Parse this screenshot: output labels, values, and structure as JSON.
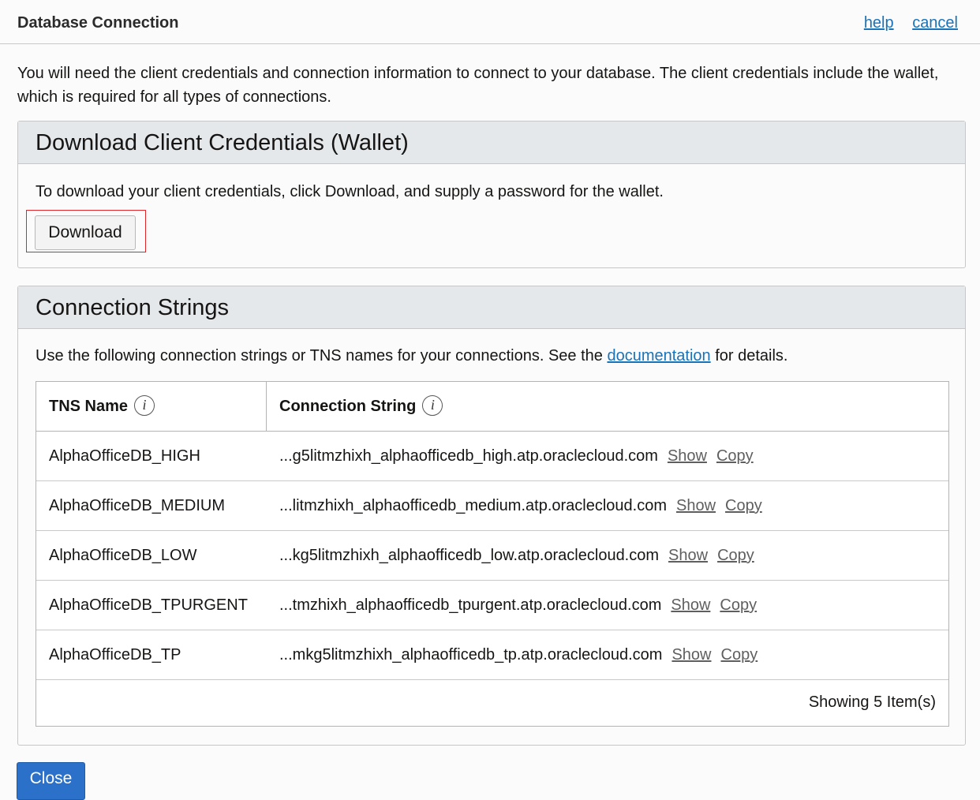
{
  "header": {
    "title": "Database Connection",
    "help_link": "help",
    "cancel_link": "cancel"
  },
  "intro_text": "You will need the client credentials and connection information to connect to your database. The client credentials include the wallet, which is required for all types of connections.",
  "wallet_panel": {
    "title": "Download Client Credentials (Wallet)",
    "description": "To download your client credentials, click Download, and supply a password for the wallet.",
    "download_button": "Download"
  },
  "connections_panel": {
    "title": "Connection Strings",
    "description_before": "Use the following connection strings or TNS names for your connections. See the ",
    "documentation_link": "documentation",
    "description_after": " for details.",
    "columns": {
      "tns_name": "TNS Name",
      "connection_string": "Connection String",
      "info_icon_glyph": "i"
    },
    "rows": [
      {
        "tns": "AlphaOfficeDB_HIGH",
        "conn": "...g5litmzhixh_alphaofficedb_high.atp.oraclecloud.com",
        "show": "Show",
        "copy": "Copy"
      },
      {
        "tns": "AlphaOfficeDB_MEDIUM",
        "conn": "...litmzhixh_alphaofficedb_medium.atp.oraclecloud.com",
        "show": "Show",
        "copy": "Copy"
      },
      {
        "tns": "AlphaOfficeDB_LOW",
        "conn": "...kg5litmzhixh_alphaofficedb_low.atp.oraclecloud.com",
        "show": "Show",
        "copy": "Copy"
      },
      {
        "tns": "AlphaOfficeDB_TPURGENT",
        "conn": "...tmzhixh_alphaofficedb_tpurgent.atp.oraclecloud.com",
        "show": "Show",
        "copy": "Copy"
      },
      {
        "tns": "AlphaOfficeDB_TP",
        "conn": "...mkg5litmzhixh_alphaofficedb_tp.atp.oraclecloud.com",
        "show": "Show",
        "copy": "Copy"
      }
    ],
    "footer": "Showing 5 Item(s)"
  },
  "close_button": "Close",
  "colors": {
    "link": "#1a73b8",
    "primary_button": "#2b70c9",
    "highlight_border": "#e0252b",
    "panel_header_bg": "#e4e8eb"
  }
}
